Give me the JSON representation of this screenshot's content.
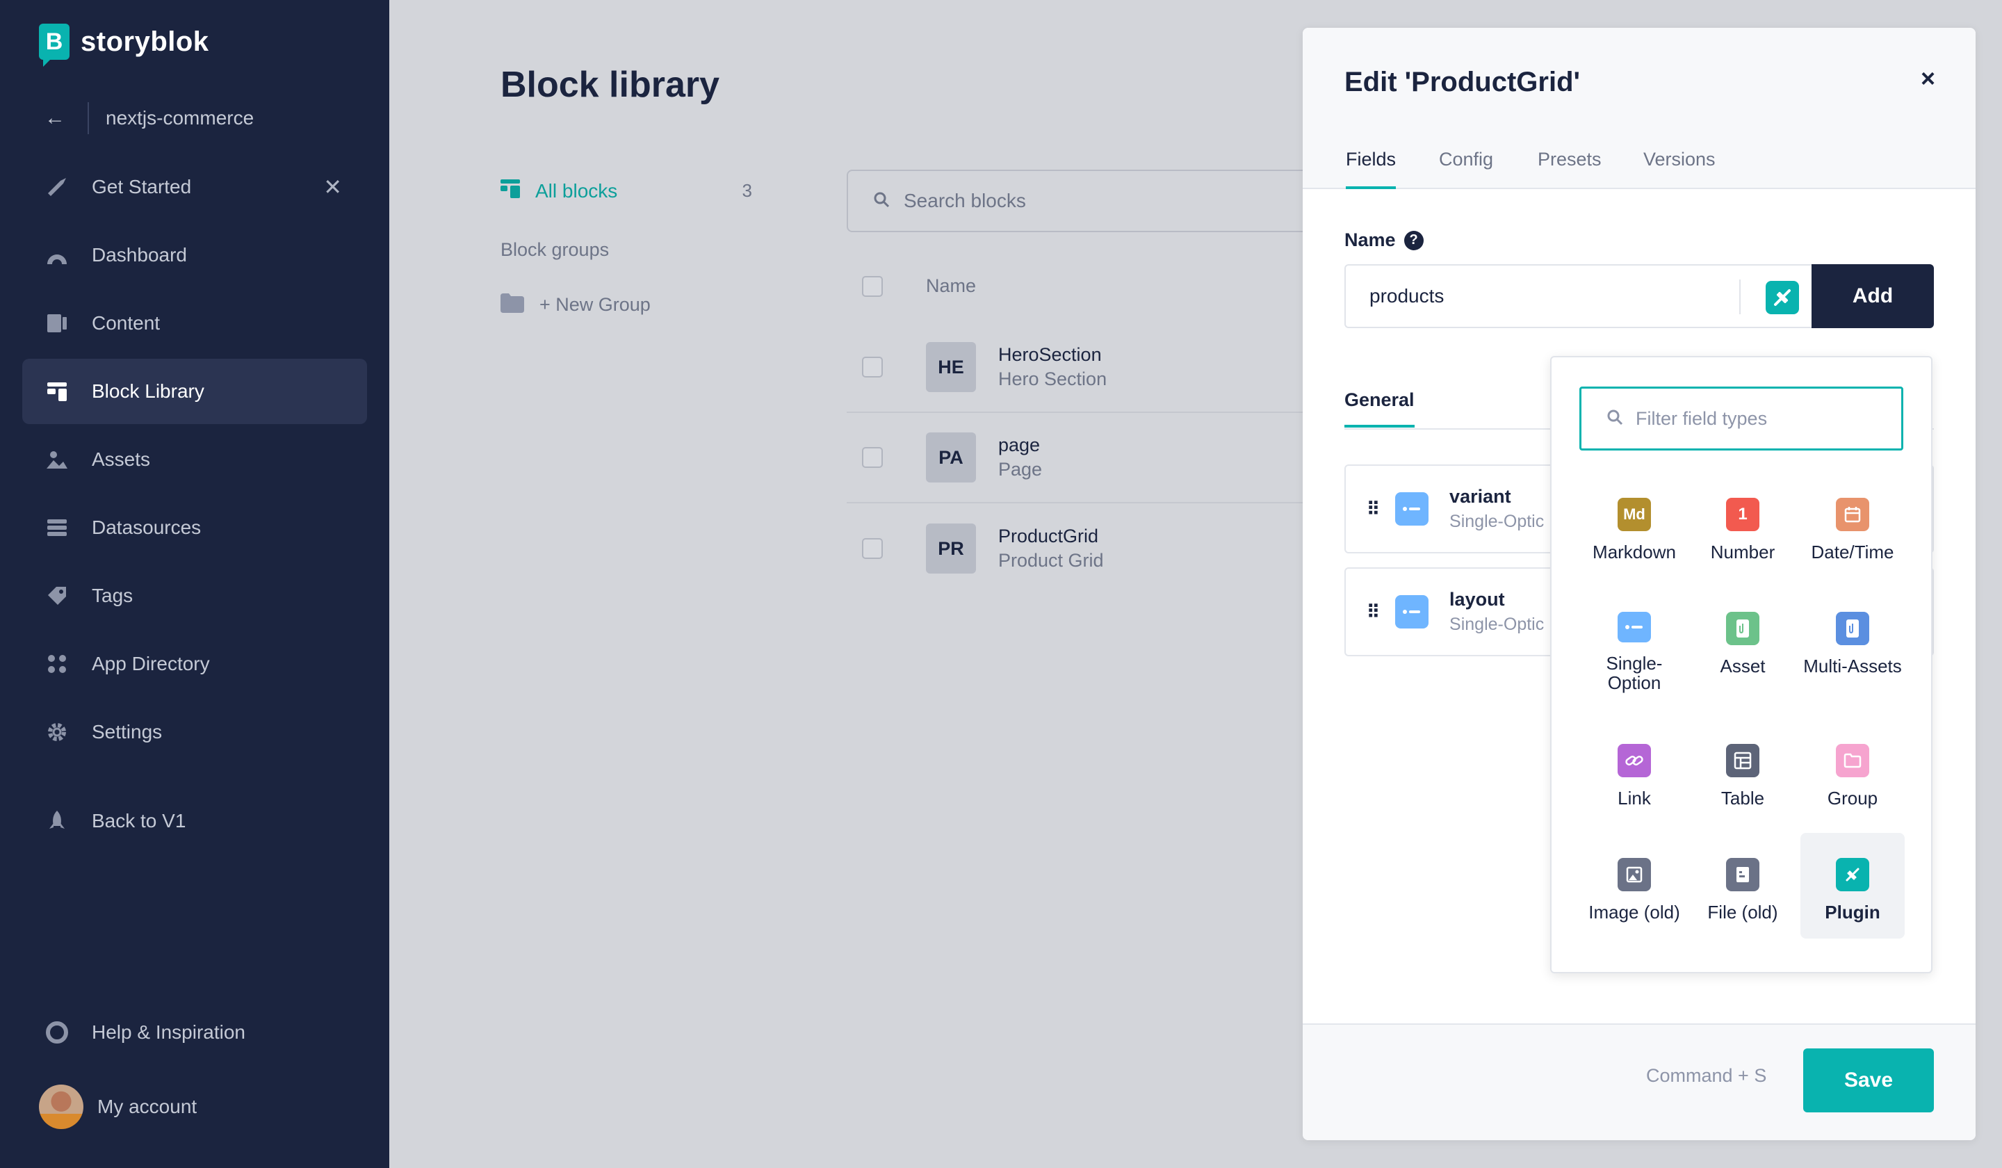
{
  "brand": {
    "name": "storyblok",
    "logo_letter": "B",
    "accent": "#09b3af",
    "sidebar_bg": "#1b243f"
  },
  "space": {
    "back_label": "nextjs-commerce"
  },
  "sidebar": {
    "items": [
      {
        "label": "Get Started",
        "icon": "rocket-hand-icon"
      },
      {
        "label": "Dashboard",
        "icon": "gauge-icon"
      },
      {
        "label": "Content",
        "icon": "content-icon"
      },
      {
        "label": "Block Library",
        "icon": "blocks-icon"
      },
      {
        "label": "Assets",
        "icon": "image-icon"
      },
      {
        "label": "Datasources",
        "icon": "database-icon"
      },
      {
        "label": "Tags",
        "icon": "tag-icon"
      },
      {
        "label": "App Directory",
        "icon": "apps-icon"
      },
      {
        "label": "Settings",
        "icon": "gear-icon"
      },
      {
        "label": "Back to V1",
        "icon": "rocket-icon"
      },
      {
        "label": "Help & Inspiration",
        "icon": "lifebuoy-icon"
      }
    ],
    "account_label": "My account"
  },
  "main": {
    "title": "Block library",
    "all_blocks_label": "All blocks",
    "all_blocks_count": "3",
    "groups_title": "Block groups",
    "new_group_label": "+ New Group",
    "search_placeholder": "Search blocks",
    "column_name": "Name",
    "rows": [
      {
        "badge": "HE",
        "name": "HeroSection",
        "display": "Hero Section"
      },
      {
        "badge": "PA",
        "name": "page",
        "display": "Page"
      },
      {
        "badge": "PR",
        "name": "ProductGrid",
        "display": "Product Grid"
      }
    ]
  },
  "panel": {
    "title": "Edit 'ProductGrid'",
    "close": "×",
    "tabs": [
      "Fields",
      "Config",
      "Presets",
      "Versions"
    ],
    "name_label": "Name",
    "help": "?",
    "name_value": "products",
    "add_label": "Add",
    "general_tab": "General",
    "fields": [
      {
        "name": "variant",
        "type": "Single-Optic"
      },
      {
        "name": "layout",
        "type": "Single-Optic"
      }
    ],
    "shortcut": "Command + S",
    "save_label": "Save"
  },
  "field_types": {
    "filter_placeholder": "Filter field types",
    "items": [
      {
        "label": "Markdown",
        "glyph": "Md",
        "color": "#b38f2e",
        "icon": "markdown-icon"
      },
      {
        "label": "Number",
        "glyph": "1",
        "color": "#f25a4f",
        "icon": "number-icon"
      },
      {
        "label": "Date/Time",
        "glyph": "",
        "color": "#e8936c",
        "icon": "calendar-icon"
      },
      {
        "label": "Single-Option",
        "glyph": "",
        "color": "#6fb5ff",
        "icon": "single-option-icon"
      },
      {
        "label": "Asset",
        "glyph": "",
        "color": "#6cc28a",
        "icon": "asset-icon"
      },
      {
        "label": "Multi-Assets",
        "glyph": "",
        "color": "#5b8fe0",
        "icon": "multi-assets-icon"
      },
      {
        "label": "Link",
        "glyph": "",
        "color": "#b566d6",
        "icon": "link-icon"
      },
      {
        "label": "Table",
        "glyph": "",
        "color": "#5d6478",
        "icon": "table-icon"
      },
      {
        "label": "Group",
        "glyph": "",
        "color": "#f6a4cf",
        "icon": "folder-icon"
      },
      {
        "label": "Image (old)",
        "glyph": "",
        "color": "#6b7287",
        "icon": "image-old-icon"
      },
      {
        "label": "File (old)",
        "glyph": "",
        "color": "#6b7287",
        "icon": "file-old-icon"
      },
      {
        "label": "Plugin",
        "glyph": "",
        "color": "#09b3af",
        "icon": "plugin-icon"
      }
    ],
    "selected": "Plugin"
  }
}
